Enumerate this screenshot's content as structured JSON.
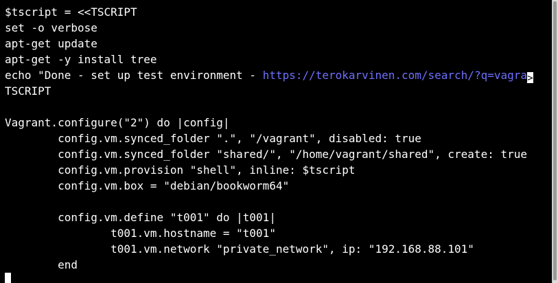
{
  "terminal": {
    "lines": [
      "$tscript = <<TSCRIPT",
      "set -o verbose",
      "apt-get update",
      "apt-get -y install tree",
      "",
      "TSCRIPT",
      "",
      "Vagrant.configure(\"2\") do |config|",
      "        config.vm.synced_folder \".\", \"/vagrant\", disabled: true",
      "        config.vm.synced_folder \"shared/\", \"/home/vagrant/shared\", create: true",
      "        config.vm.provision \"shell\", inline: $tscript",
      "        config.vm.box = \"debian/bookworm64\"",
      "",
      "        config.vm.define \"t001\" do |t001|",
      "                t001.vm.hostname = \"t001\"",
      "                t001.vm.network \"private_network\", ip: \"192.168.88.101\"",
      "        end"
    ],
    "echo_line": {
      "prefix": "echo \"Done - set up test environment - ",
      "url": "https://terokarvinen.com/search/?q=vagra",
      "overflow_marker": ">"
    },
    "colors": {
      "background": "#000000",
      "text": "#ffffff",
      "url": "#6f6fff"
    }
  }
}
